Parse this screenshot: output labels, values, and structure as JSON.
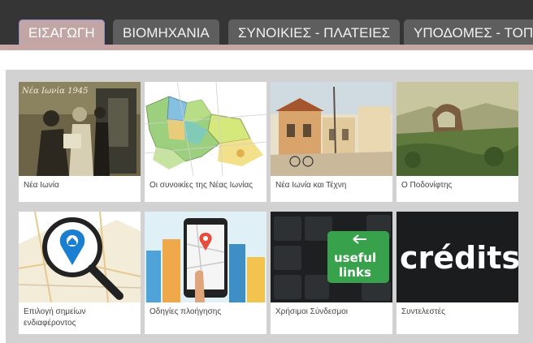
{
  "tabs": [
    {
      "label": "ΕΙΣΑΓΩΓΗ",
      "active": true
    },
    {
      "label": "ΒΙΟΜΗΧΑΝΙΑ",
      "active": false
    },
    {
      "label": "ΣΥΝΟΙΚΙΕΣ - ΠΛΑΤΕΙΕΣ",
      "active": false
    },
    {
      "label": "ΥΠΟΔΟΜΕΣ - ΤΟΠ",
      "active": false
    }
  ],
  "cards": [
    {
      "caption": "Νέα Ιωνία",
      "thumb_text": "Νέα Ιωνία 1945",
      "icon": "historic-photo-icon"
    },
    {
      "caption": "Οι συνοικίες της Νέας Ιωνίας",
      "icon": "district-map-icon"
    },
    {
      "caption": "Νέα Ιωνία και Τέχνη",
      "icon": "painting-icon"
    },
    {
      "caption": "Ο Ποδονίφτης",
      "icon": "landscape-painting-icon"
    },
    {
      "caption": "Επιλογή σημείων ενδιαφέροντος",
      "icon": "map-magnifier-pin-icon"
    },
    {
      "caption": "Οδηγίες πλοήγησης",
      "icon": "phone-navigation-icon"
    },
    {
      "caption": "Χρήσιμοι Σύνδεσμοι",
      "thumb_text": "useful links",
      "icon": "keyboard-key-icon"
    },
    {
      "caption": "Συντελεστές",
      "thumb_text": "crédits",
      "icon": "credits-icon"
    }
  ],
  "colors": {
    "tabbar_bg": "#353535",
    "tab_bg": "#5e5e5e",
    "tab_active_bg": "#c2a5a5",
    "gallery_bg": "#d2d2d2",
    "useful_links_key": "#37a24b"
  }
}
